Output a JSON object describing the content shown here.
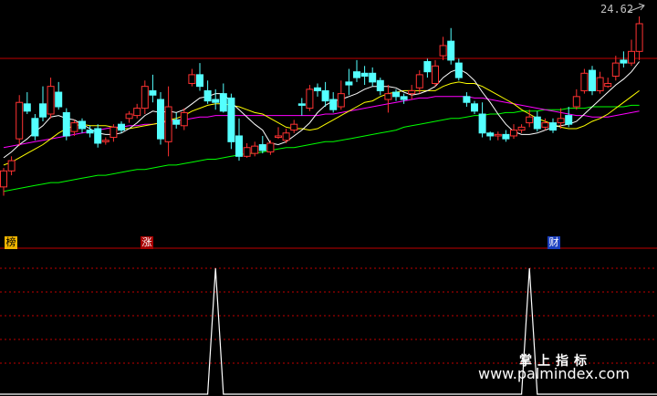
{
  "price_label": "24.62",
  "badges": {
    "bang": "榜",
    "zhang": "涨",
    "cai": "财"
  },
  "watermark": {
    "title": "掌上指标",
    "url": "www.palmindex.com"
  },
  "colors": {
    "up": "#ff3232",
    "down": "#54ffff",
    "ma5": "#ffffff",
    "ma10": "#ffff00",
    "ma20": "#ff00ff",
    "ma60": "#00ff00",
    "grid": "#c00000",
    "indicator": "#ffffff"
  },
  "chart_data": [
    {
      "type": "candlestick",
      "title": "",
      "xlabel": "",
      "ylabel": "",
      "ylim": [
        10.7,
        25.1
      ],
      "last_price": 24.62,
      "candles": [
        [
          12.9,
          14.0,
          12.3,
          14.2
        ],
        [
          14.0,
          14.7,
          13.7,
          15.0
        ],
        [
          16.2,
          18.7,
          15.7,
          19.2
        ],
        [
          18.6,
          18.1,
          17.9,
          19.4
        ],
        [
          17.6,
          16.4,
          16.1,
          17.9
        ],
        [
          18.6,
          17.7,
          17.4,
          19.8
        ],
        [
          17.9,
          19.8,
          17.6,
          20.4
        ],
        [
          19.4,
          18.4,
          18.2,
          20.1
        ],
        [
          18.0,
          16.4,
          16.1,
          18.3
        ],
        [
          16.7,
          17.3,
          16.4,
          17.5
        ],
        [
          17.4,
          16.9,
          16.6,
          17.6
        ],
        [
          16.8,
          16.6,
          16.3,
          17.1
        ],
        [
          16.9,
          15.9,
          15.6,
          17.2
        ],
        [
          16.0,
          16.1,
          15.8,
          16.3
        ],
        [
          16.3,
          17.0,
          16.0,
          17.2
        ],
        [
          17.2,
          16.8,
          16.6,
          17.4
        ],
        [
          17.6,
          17.9,
          17.3,
          18.1
        ],
        [
          17.8,
          18.3,
          17.6,
          18.6
        ],
        [
          18.3,
          19.8,
          17.9,
          20.2
        ],
        [
          19.5,
          19.2,
          18.7,
          20.6
        ],
        [
          18.9,
          16.2,
          15.8,
          19.4
        ],
        [
          16.0,
          18.4,
          15.0,
          19.8
        ],
        [
          17.5,
          17.2,
          16.9,
          18.0
        ],
        [
          17.1,
          18.0,
          16.8,
          18.3
        ],
        [
          20.0,
          20.6,
          19.8,
          21.0
        ],
        [
          20.6,
          19.8,
          19.5,
          21.4
        ],
        [
          19.5,
          18.8,
          18.6,
          20.2
        ],
        [
          18.9,
          18.7,
          18.2,
          19.6
        ],
        [
          19.3,
          18.1,
          18.0,
          20.0
        ],
        [
          19.0,
          16.0,
          15.5,
          19.3
        ],
        [
          16.4,
          15.0,
          14.7,
          17.6
        ],
        [
          15.0,
          15.6,
          14.9,
          15.9
        ],
        [
          15.2,
          15.7,
          15.0,
          16.0
        ],
        [
          15.8,
          15.4,
          15.2,
          16.4
        ],
        [
          15.3,
          15.9,
          15.1,
          16.1
        ],
        [
          16.3,
          16.4,
          16.2,
          17.0
        ],
        [
          16.1,
          16.6,
          15.9,
          16.9
        ],
        [
          16.8,
          17.2,
          16.6,
          17.5
        ],
        [
          18.6,
          18.5,
          17.8,
          19.0
        ],
        [
          18.3,
          19.6,
          18.1,
          19.9
        ],
        [
          19.7,
          19.5,
          19.1,
          20.0
        ],
        [
          19.5,
          18.8,
          18.4,
          20.1
        ],
        [
          18.9,
          18.2,
          18.0,
          19.4
        ],
        [
          18.4,
          19.3,
          18.2,
          20.2
        ],
        [
          20.1,
          19.9,
          19.2,
          21.0
        ],
        [
          20.8,
          20.4,
          20.1,
          21.6
        ],
        [
          20.7,
          20.5,
          19.9,
          21.2
        ],
        [
          20.7,
          20.1,
          19.8,
          21.1
        ],
        [
          20.2,
          19.5,
          19.2,
          20.4
        ],
        [
          18.9,
          19.3,
          18.0,
          19.9
        ],
        [
          19.4,
          19.1,
          18.8,
          19.6
        ],
        [
          19.1,
          18.9,
          18.6,
          19.3
        ],
        [
          19.3,
          19.5,
          18.9,
          19.9
        ],
        [
          19.7,
          20.6,
          19.3,
          20.9
        ],
        [
          21.5,
          20.8,
          20.4,
          21.7
        ],
        [
          20.0,
          21.2,
          19.8,
          21.6
        ],
        [
          21.9,
          22.6,
          21.6,
          23.2
        ],
        [
          22.9,
          21.6,
          21.3,
          23.8
        ],
        [
          21.4,
          20.4,
          20.2,
          21.7
        ],
        [
          19.1,
          18.7,
          18.4,
          19.4
        ],
        [
          18.6,
          18.1,
          17.9,
          18.8
        ],
        [
          17.9,
          16.6,
          16.3,
          18.7
        ],
        [
          16.6,
          16.4,
          16.1,
          16.7
        ],
        [
          16.4,
          16.5,
          16.1,
          16.7
        ],
        [
          16.5,
          16.2,
          16.0,
          16.8
        ],
        [
          16.4,
          16.8,
          16.2,
          17.2
        ],
        [
          16.8,
          17.0,
          16.6,
          17.2
        ],
        [
          17.3,
          17.7,
          17.0,
          18.2
        ],
        [
          17.7,
          16.9,
          16.7,
          18.1
        ],
        [
          17.0,
          17.3,
          16.8,
          17.6
        ],
        [
          17.3,
          16.8,
          16.6,
          17.6
        ],
        [
          17.3,
          17.6,
          16.9,
          18.3
        ],
        [
          17.8,
          17.2,
          17.0,
          18.4
        ],
        [
          18.4,
          19.1,
          18.2,
          19.6
        ],
        [
          19.5,
          20.7,
          19.3,
          21.0
        ],
        [
          20.9,
          19.5,
          19.2,
          21.2
        ],
        [
          19.5,
          20.4,
          19.3,
          20.8
        ],
        [
          19.8,
          20.0,
          19.7,
          20.4
        ],
        [
          20.5,
          21.4,
          20.2,
          21.9
        ],
        [
          21.6,
          21.4,
          21.1,
          22.2
        ],
        [
          21.4,
          22.2,
          21.2,
          23.0
        ],
        [
          22.2,
          24.1,
          21.6,
          24.6
        ]
      ],
      "ma5": [
        14.9,
        15.3,
        15.8,
        16.2,
        16.7,
        17.1,
        17.7,
        17.8,
        17.6,
        17.5,
        17.2,
        16.9,
        16.6,
        16.5,
        16.5,
        16.6,
        16.9,
        17.3,
        17.8,
        18.1,
        18.0,
        18.1,
        18.0,
        18.2,
        18.6,
        19.0,
        19.1,
        19.3,
        19.3,
        18.7,
        18.2,
        17.7,
        17.2,
        16.8,
        15.9,
        15.8,
        16.0,
        16.4,
        16.8,
        17.3,
        18.0,
        18.5,
        18.8,
        18.9,
        19.1,
        19.3,
        19.6,
        19.8,
        19.8,
        19.8,
        19.7,
        19.4,
        19.2,
        19.3,
        19.5,
        19.8,
        20.4,
        20.8,
        21.0,
        20.7,
        20.2,
        19.4,
        18.7,
        17.9,
        17.2,
        16.7,
        16.5,
        16.5,
        16.6,
        16.8,
        17.0,
        17.1,
        17.2,
        17.4,
        17.9,
        18.4,
        18.9,
        19.4,
        19.9,
        20.3,
        20.8,
        21.5
      ],
      "ma10": [
        14.4,
        14.6,
        14.9,
        15.2,
        15.5,
        15.8,
        16.2,
        16.6,
        16.9,
        17.1,
        17.2,
        17.1,
        17.1,
        17.1,
        17.0,
        16.9,
        16.9,
        17.0,
        17.1,
        17.2,
        17.3,
        17.5,
        17.6,
        17.8,
        18.1,
        18.3,
        18.5,
        18.6,
        18.6,
        18.5,
        18.4,
        18.2,
        18.0,
        17.9,
        17.6,
        17.3,
        17.0,
        16.9,
        16.9,
        16.8,
        16.9,
        17.2,
        17.5,
        17.8,
        18.1,
        18.4,
        18.7,
        18.8,
        19.1,
        19.3,
        19.4,
        19.5,
        19.5,
        19.5,
        19.5,
        19.5,
        19.8,
        20.0,
        20.1,
        20.0,
        20.0,
        19.8,
        19.5,
        19.2,
        18.9,
        18.6,
        18.2,
        17.9,
        17.6,
        17.4,
        17.2,
        17.0,
        16.9,
        16.9,
        17.1,
        17.4,
        17.6,
        17.9,
        18.3,
        18.7,
        19.1,
        19.5
      ],
      "ma20": [
        15.6,
        15.7,
        15.8,
        15.9,
        16.0,
        16.1,
        16.2,
        16.3,
        16.4,
        16.5,
        16.6,
        16.7,
        16.8,
        16.9,
        17.0,
        17.0,
        17.1,
        17.1,
        17.2,
        17.2,
        17.3,
        17.4,
        17.5,
        17.5,
        17.6,
        17.7,
        17.7,
        17.8,
        17.8,
        17.8,
        17.8,
        17.8,
        17.8,
        17.8,
        17.8,
        17.8,
        17.8,
        17.8,
        17.8,
        17.8,
        17.8,
        17.9,
        17.9,
        18.0,
        18.1,
        18.2,
        18.3,
        18.4,
        18.5,
        18.6,
        18.7,
        18.8,
        18.9,
        19.0,
        19.0,
        19.1,
        19.1,
        19.1,
        19.1,
        19.1,
        19.0,
        19.0,
        18.9,
        18.8,
        18.7,
        18.6,
        18.5,
        18.4,
        18.3,
        18.2,
        18.1,
        18.0,
        17.9,
        17.8,
        17.8,
        17.7,
        17.7,
        17.7,
        17.8,
        17.9,
        18.0,
        18.1
      ],
      "ma60": [
        12.6,
        12.7,
        12.8,
        12.9,
        13.0,
        13.1,
        13.2,
        13.2,
        13.3,
        13.4,
        13.5,
        13.6,
        13.7,
        13.7,
        13.8,
        13.9,
        14.0,
        14.1,
        14.1,
        14.2,
        14.3,
        14.4,
        14.4,
        14.5,
        14.6,
        14.7,
        14.8,
        14.8,
        14.9,
        15.0,
        15.1,
        15.2,
        15.2,
        15.3,
        15.4,
        15.5,
        15.6,
        15.6,
        15.7,
        15.8,
        15.9,
        16.0,
        16.0,
        16.1,
        16.2,
        16.3,
        16.4,
        16.5,
        16.6,
        16.7,
        16.8,
        17.0,
        17.1,
        17.2,
        17.3,
        17.4,
        17.5,
        17.6,
        17.6,
        17.7,
        17.8,
        17.8,
        17.9,
        17.9,
        18.0,
        18.0,
        18.1,
        18.1,
        18.1,
        18.2,
        18.2,
        18.2,
        18.3,
        18.3,
        18.3,
        18.4,
        18.4,
        18.4,
        18.4,
        18.4,
        18.5,
        18.5
      ]
    },
    {
      "type": "line",
      "title": "",
      "xlabel": "",
      "ylabel": "",
      "ylim": [
        0,
        1
      ],
      "signal_bars": [
        27,
        67
      ],
      "values": [
        0,
        0,
        0,
        0,
        0,
        0,
        0,
        0,
        0,
        0,
        0,
        0,
        0,
        0,
        0,
        0,
        0,
        0,
        0,
        0,
        0,
        0,
        0,
        0,
        0,
        0,
        0,
        1,
        0,
        0,
        0,
        0,
        0,
        0,
        0,
        0,
        0,
        0,
        0,
        0,
        0,
        0,
        0,
        0,
        0,
        0,
        0,
        0,
        0,
        0,
        0,
        0,
        0,
        0,
        0,
        0,
        0,
        0,
        0,
        0,
        0,
        0,
        0,
        0,
        0,
        0,
        0,
        1,
        0,
        0,
        0,
        0,
        0,
        0,
        0,
        0,
        0,
        0,
        0,
        0,
        0,
        0
      ]
    }
  ]
}
